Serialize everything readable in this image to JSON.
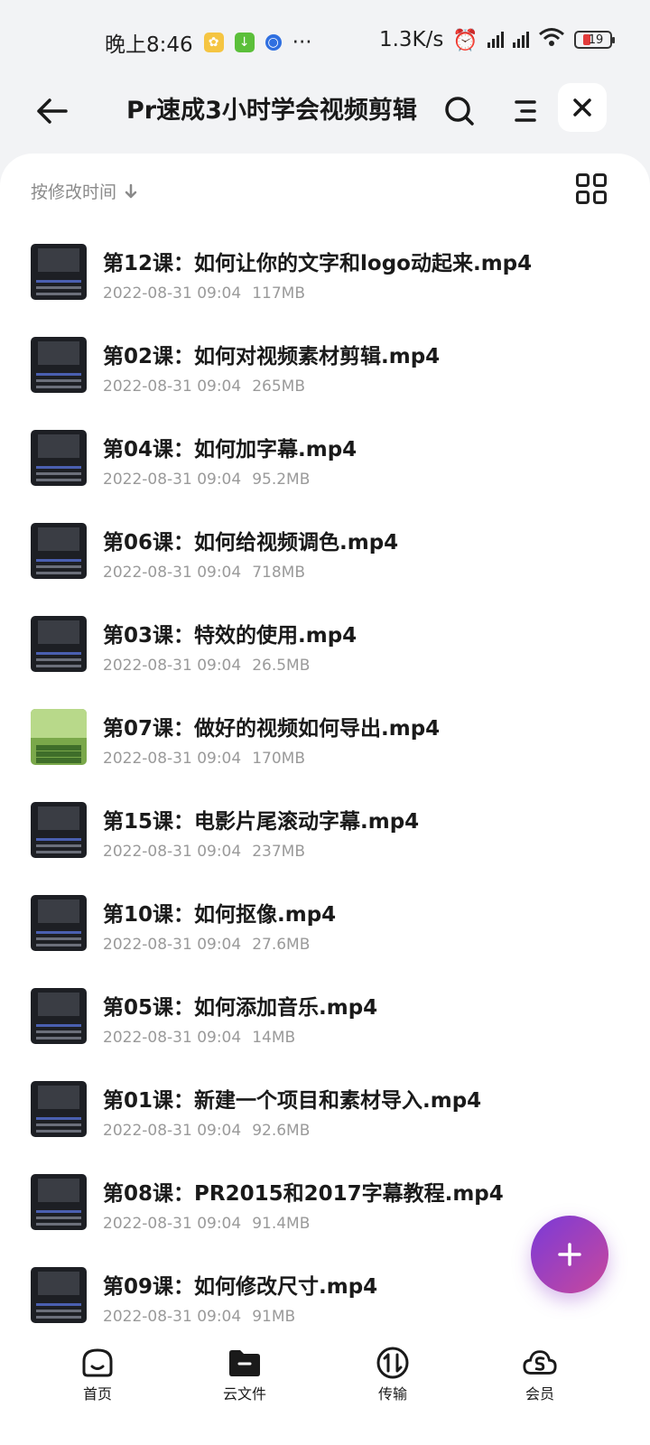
{
  "status_bar": {
    "time": "晚上8:46",
    "dots": "···",
    "network_speed": "1.3K/s",
    "battery_level": "19"
  },
  "header": {
    "title": "Pr速成3小时学会视频剪辑"
  },
  "sort": {
    "label": "按修改时间"
  },
  "files": [
    {
      "name": "第12课：如何让你的文字和logo动起来.mp4",
      "date": "2022-08-31 09:04",
      "size": "117MB",
      "thumb": "editor"
    },
    {
      "name": "第02课：如何对视频素材剪辑.mp4",
      "date": "2022-08-31 09:04",
      "size": "265MB",
      "thumb": "editor"
    },
    {
      "name": "第04课：如何加字幕.mp4",
      "date": "2022-08-31 09:04",
      "size": "95.2MB",
      "thumb": "editor"
    },
    {
      "name": "第06课：如何给视频调色.mp4",
      "date": "2022-08-31 09:04",
      "size": "718MB",
      "thumb": "editor"
    },
    {
      "name": "第03课：特效的使用.mp4",
      "date": "2022-08-31 09:04",
      "size": "26.5MB",
      "thumb": "editor"
    },
    {
      "name": "第07课：做好的视频如何导出.mp4",
      "date": "2022-08-31 09:04",
      "size": "170MB",
      "thumb": "nature"
    },
    {
      "name": "第15课：电影片尾滚动字幕.mp4",
      "date": "2022-08-31 09:04",
      "size": "237MB",
      "thumb": "editor"
    },
    {
      "name": "第10课：如何抠像.mp4",
      "date": "2022-08-31 09:04",
      "size": "27.6MB",
      "thumb": "editor"
    },
    {
      "name": "第05课：如何添加音乐.mp4",
      "date": "2022-08-31 09:04",
      "size": "14MB",
      "thumb": "editor"
    },
    {
      "name": "第01课：新建一个项目和素材导入.mp4",
      "date": "2022-08-31 09:04",
      "size": "92.6MB",
      "thumb": "editor"
    },
    {
      "name": "第08课：PR2015和2017字幕教程.mp4",
      "date": "2022-08-31 09:04",
      "size": "91.4MB",
      "thumb": "editor"
    },
    {
      "name": "第09课：如何修改尺寸.mp4",
      "date": "2022-08-31 09:04",
      "size": "91MB",
      "thumb": "editor"
    }
  ],
  "bottom_nav": {
    "home": "首页",
    "cloud_files": "云文件",
    "transfer": "传输",
    "member": "会员"
  },
  "colors": {
    "accent_gradient_start": "#7a3ad8",
    "accent_gradient_end": "#c9489c",
    "background": "#f2f3f5",
    "text_primary": "#1a1a1a",
    "text_secondary": "#9a9a9a"
  }
}
